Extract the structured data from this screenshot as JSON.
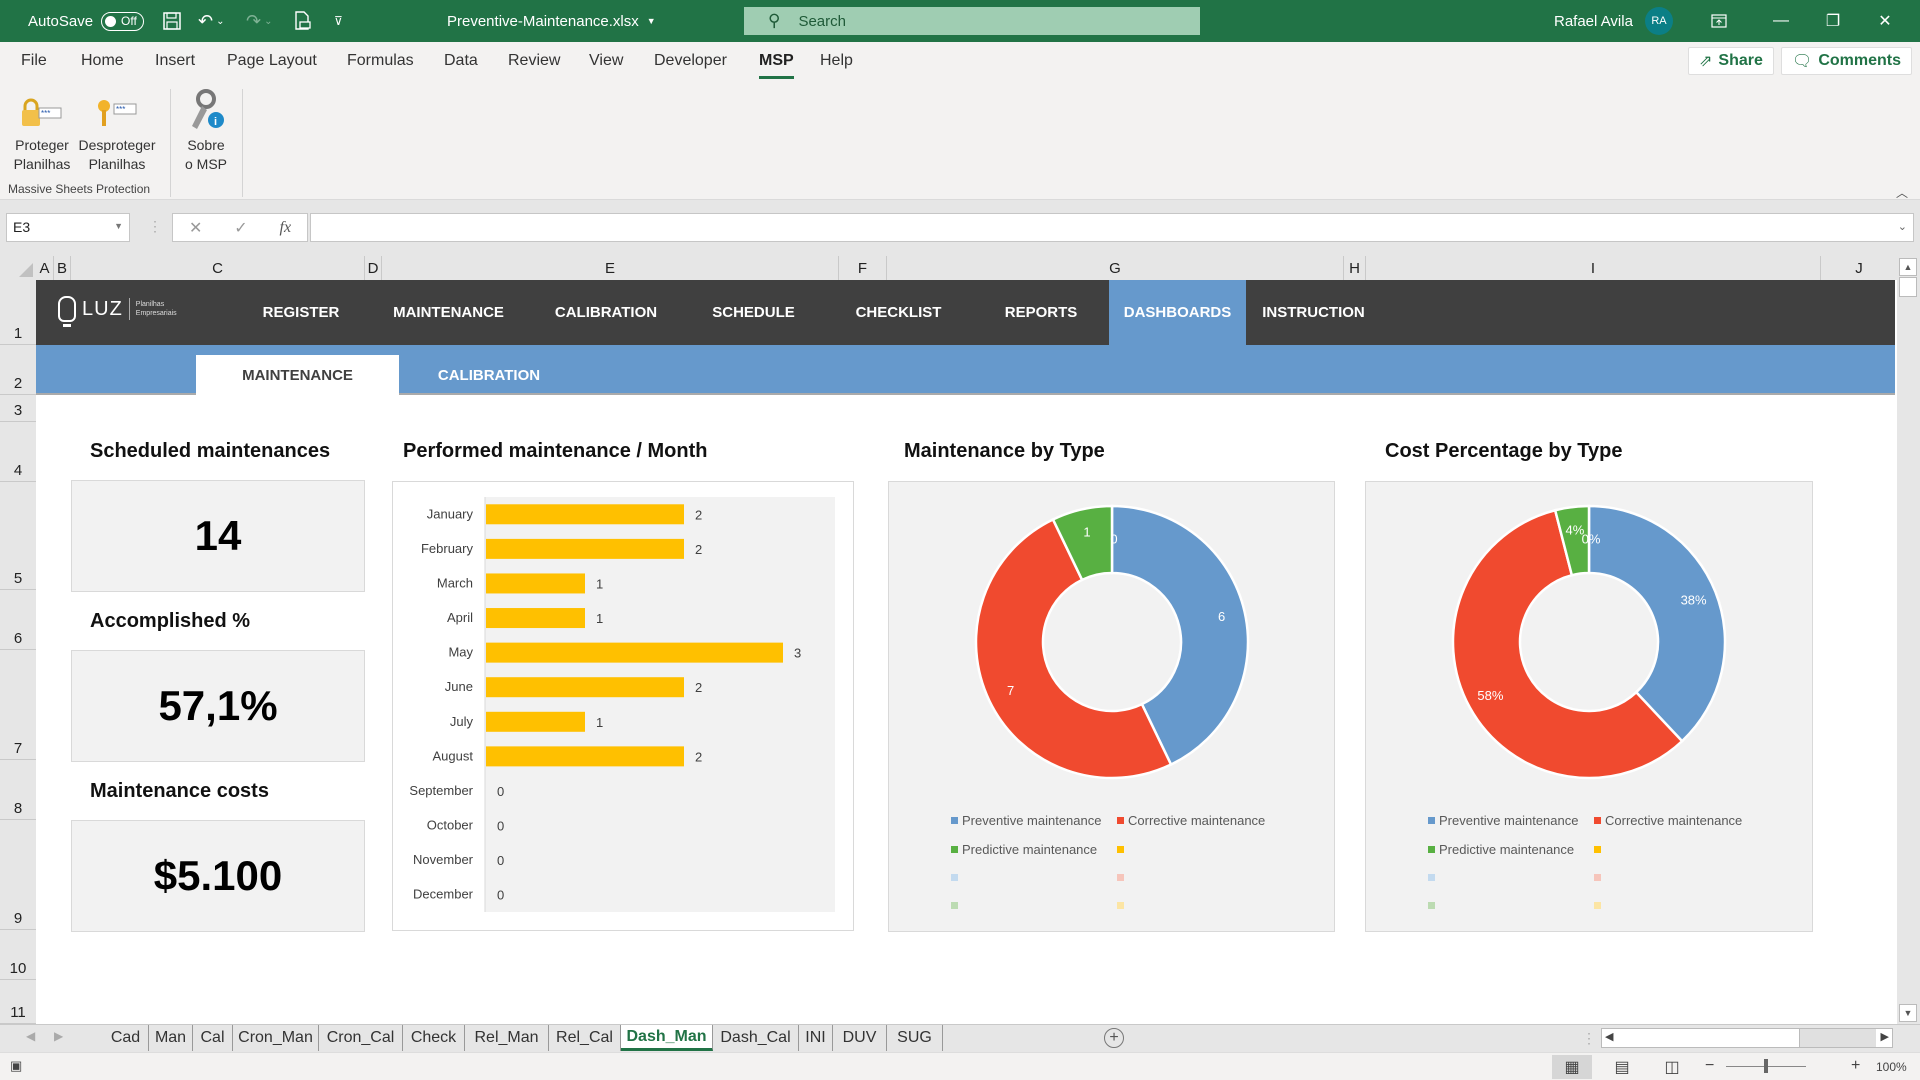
{
  "titlebar": {
    "autosave_label": "AutoSave",
    "autosave_state": "Off",
    "filename": "Preventive-Maintenance.xlsx",
    "search_placeholder": "Search",
    "user_name": "Rafael Avila",
    "user_initials": "RA"
  },
  "ribbon": {
    "tabs": [
      "File",
      "Home",
      "Insert",
      "Page Layout",
      "Formulas",
      "Data",
      "Review",
      "View",
      "Developer",
      "MSP",
      "Help"
    ],
    "active_tab": "MSP",
    "share_label": "Share",
    "comments_label": "Comments",
    "buttons": [
      {
        "line1": "Proteger",
        "line2": "Planilhas",
        "icon": "lock-password-icon"
      },
      {
        "line1": "Desproteger",
        "line2": "Planilhas",
        "icon": "key-password-icon"
      },
      {
        "line1": "Sobre",
        "line2": "o MSP",
        "icon": "key-info-icon"
      }
    ],
    "group_label": "Massive Sheets Protection"
  },
  "formula_bar": {
    "name_box": "E3",
    "formula": ""
  },
  "columns": [
    "A",
    "B",
    "C",
    "D",
    "E",
    "F",
    "G",
    "H",
    "I",
    "J"
  ],
  "rows": [
    "1",
    "2",
    "3",
    "4",
    "5",
    "6",
    "7",
    "8",
    "9",
    "10",
    "11"
  ],
  "app_nav": {
    "logo_text": "LUZ",
    "logo_sub1": "Planilhas",
    "logo_sub2": "Empresariais",
    "items": [
      "REGISTER",
      "MAINTENANCE",
      "CALIBRATION",
      "SCHEDULE",
      "CHECKLIST",
      "REPORTS",
      "DASHBOARDS",
      "INSTRUCTION"
    ],
    "active": "DASHBOARDS",
    "subtabs": [
      "MAINTENANCE",
      "CALIBRATION"
    ],
    "active_subtab": "MAINTENANCE"
  },
  "kpis": [
    {
      "label": "Scheduled maintenances",
      "value": "14"
    },
    {
      "label": "Accomplished %",
      "value": "57,1%"
    },
    {
      "label": "Maintenance costs",
      "value": "$5.100"
    }
  ],
  "colors": {
    "excel_green": "#217346",
    "nav_dark": "#404040",
    "nav_blue": "#6699cc",
    "bar_yellow": "#ffc000",
    "preventive": "#6699cc",
    "corrective": "#f04a2f",
    "predictive": "#58b042"
  },
  "chart_data": [
    {
      "type": "bar",
      "orientation": "horizontal",
      "title": "Performed maintenance / Month",
      "categories": [
        "January",
        "February",
        "March",
        "April",
        "May",
        "June",
        "July",
        "August",
        "September",
        "October",
        "November",
        "December"
      ],
      "values": [
        2,
        2,
        1,
        1,
        3,
        2,
        1,
        2,
        0,
        0,
        0,
        0
      ],
      "xlim": [
        0,
        3.5
      ],
      "data_labels": true,
      "grid": false
    },
    {
      "type": "pie",
      "variant": "doughnut",
      "title": "Maintenance by Type",
      "labels": [
        "Preventive maintenance",
        "Corrective maintenance",
        "Predictive maintenance",
        ""
      ],
      "values": [
        6,
        7,
        1,
        0
      ],
      "data_labels": [
        "6",
        "7",
        "1",
        "0"
      ],
      "legend": "bottom",
      "legend_empty_entries": 4
    },
    {
      "type": "pie",
      "variant": "doughnut",
      "title": "Cost Percentage by Type",
      "labels": [
        "Preventive maintenance",
        "Corrective maintenance",
        "Predictive maintenance",
        ""
      ],
      "values": [
        38,
        58,
        4,
        0
      ],
      "data_labels": [
        "38%",
        "58%",
        "4%",
        "0%"
      ],
      "legend": "bottom",
      "legend_empty_entries": 4
    }
  ],
  "sheet_tabs": [
    "Cad",
    "Man",
    "Cal",
    "Cron_Man",
    "Cron_Cal",
    "Check",
    "Rel_Man",
    "Rel_Cal",
    "Dash_Man",
    "Dash_Cal",
    "INI",
    "DUV",
    "SUG"
  ],
  "active_sheet": "Dash_Man",
  "statusbar": {
    "zoom_level": "100%",
    "zoom_fraction": 0.5
  }
}
